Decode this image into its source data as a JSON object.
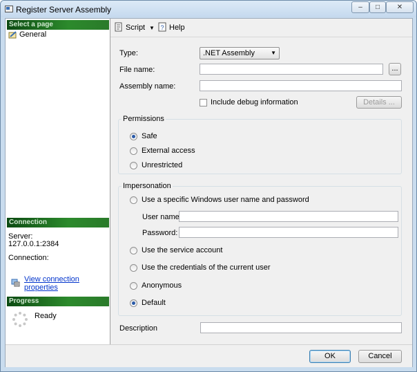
{
  "window": {
    "title": "Register Server Assembly",
    "controls": {
      "minimize": "–",
      "maximize": "□",
      "close": "✕"
    }
  },
  "left": {
    "select_page_header": "Select a page",
    "pages": [
      "General"
    ],
    "connection_header": "Connection",
    "server_label": "Server:",
    "server_value": "127.0.0.1:2384",
    "connection_label": "Connection:",
    "connection_value": "",
    "view_connection_link": "View connection properties",
    "progress_header": "Progress",
    "progress_status": "Ready"
  },
  "toolbar": {
    "script_label": "Script",
    "help_label": "Help"
  },
  "form": {
    "type_label": "Type:",
    "type_value": ".NET Assembly",
    "file_name_label": "File name:",
    "file_name_value": "",
    "browse_label": "...",
    "assembly_name_label": "Assembly name:",
    "assembly_name_value": "",
    "include_debug_label": "Include debug information",
    "details_label": "Details ...",
    "permissions": {
      "title": "Permissions",
      "options": [
        "Safe",
        "External access",
        "Unrestricted"
      ],
      "selected": "Safe"
    },
    "impersonation": {
      "title": "Impersonation",
      "specific_user_label": "Use a specific Windows user name and password",
      "user_name_label": "User name:",
      "user_name_value": "",
      "password_label": "Password:",
      "password_value": "",
      "service_account_label": "Use the service account",
      "current_user_label": "Use the credentials of the current user",
      "anonymous_label": "Anonymous",
      "default_label": "Default",
      "selected": "Default"
    },
    "description_label": "Description",
    "description_value": ""
  },
  "buttons": {
    "ok_label": "OK",
    "cancel_label": "Cancel"
  },
  "colors": {
    "header_green": "#2c8a2c",
    "link_blue": "#0033cc",
    "window_frame": "#c9dcee"
  }
}
